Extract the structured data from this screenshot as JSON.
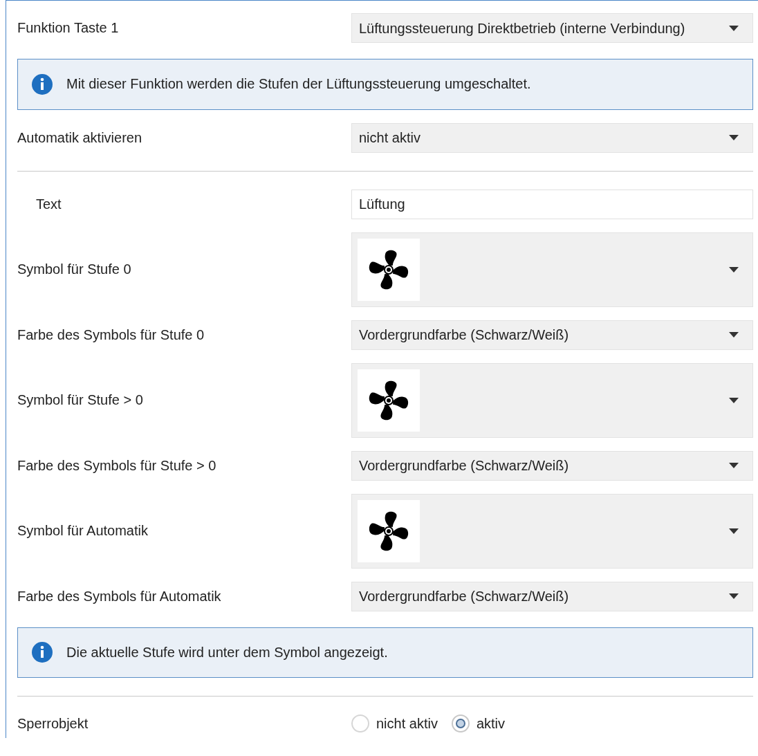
{
  "rows": [
    {
      "kind": "select",
      "label": "Funktion Taste 1",
      "value": "Lüftungssteuerung Direktbetrieb (interne Verbindung)"
    },
    {
      "kind": "info",
      "text": "Mit dieser Funktion werden die Stufen der Lüftungssteuerung umgeschaltet."
    },
    {
      "kind": "select",
      "label": "Automatik aktivieren",
      "value": "nicht aktiv"
    },
    {
      "kind": "divider"
    },
    {
      "kind": "text",
      "label": "Text",
      "value": "Lüftung"
    },
    {
      "kind": "symbol",
      "label": "Symbol für Stufe 0"
    },
    {
      "kind": "select",
      "label": "Farbe des Symbols für Stufe 0",
      "value": "Vordergrundfarbe (Schwarz/Weiß)"
    },
    {
      "kind": "symbol",
      "label": "Symbol für Stufe > 0"
    },
    {
      "kind": "select",
      "label": "Farbe des Symbols für Stufe > 0",
      "value": "Vordergrundfarbe (Schwarz/Weiß)"
    },
    {
      "kind": "symbol",
      "label": "Symbol für Automatik"
    },
    {
      "kind": "select",
      "label": "Farbe des Symbols für Automatik",
      "value": "Vordergrundfarbe (Schwarz/Weiß)"
    },
    {
      "kind": "info",
      "text": "Die aktuelle Stufe wird unter dem Symbol angezeigt."
    },
    {
      "kind": "divider"
    },
    {
      "kind": "radio",
      "label": "Sperrobjekt",
      "options": [
        {
          "label": "nicht aktiv",
          "selected": false
        },
        {
          "label": "aktiv",
          "selected": true
        }
      ]
    }
  ]
}
